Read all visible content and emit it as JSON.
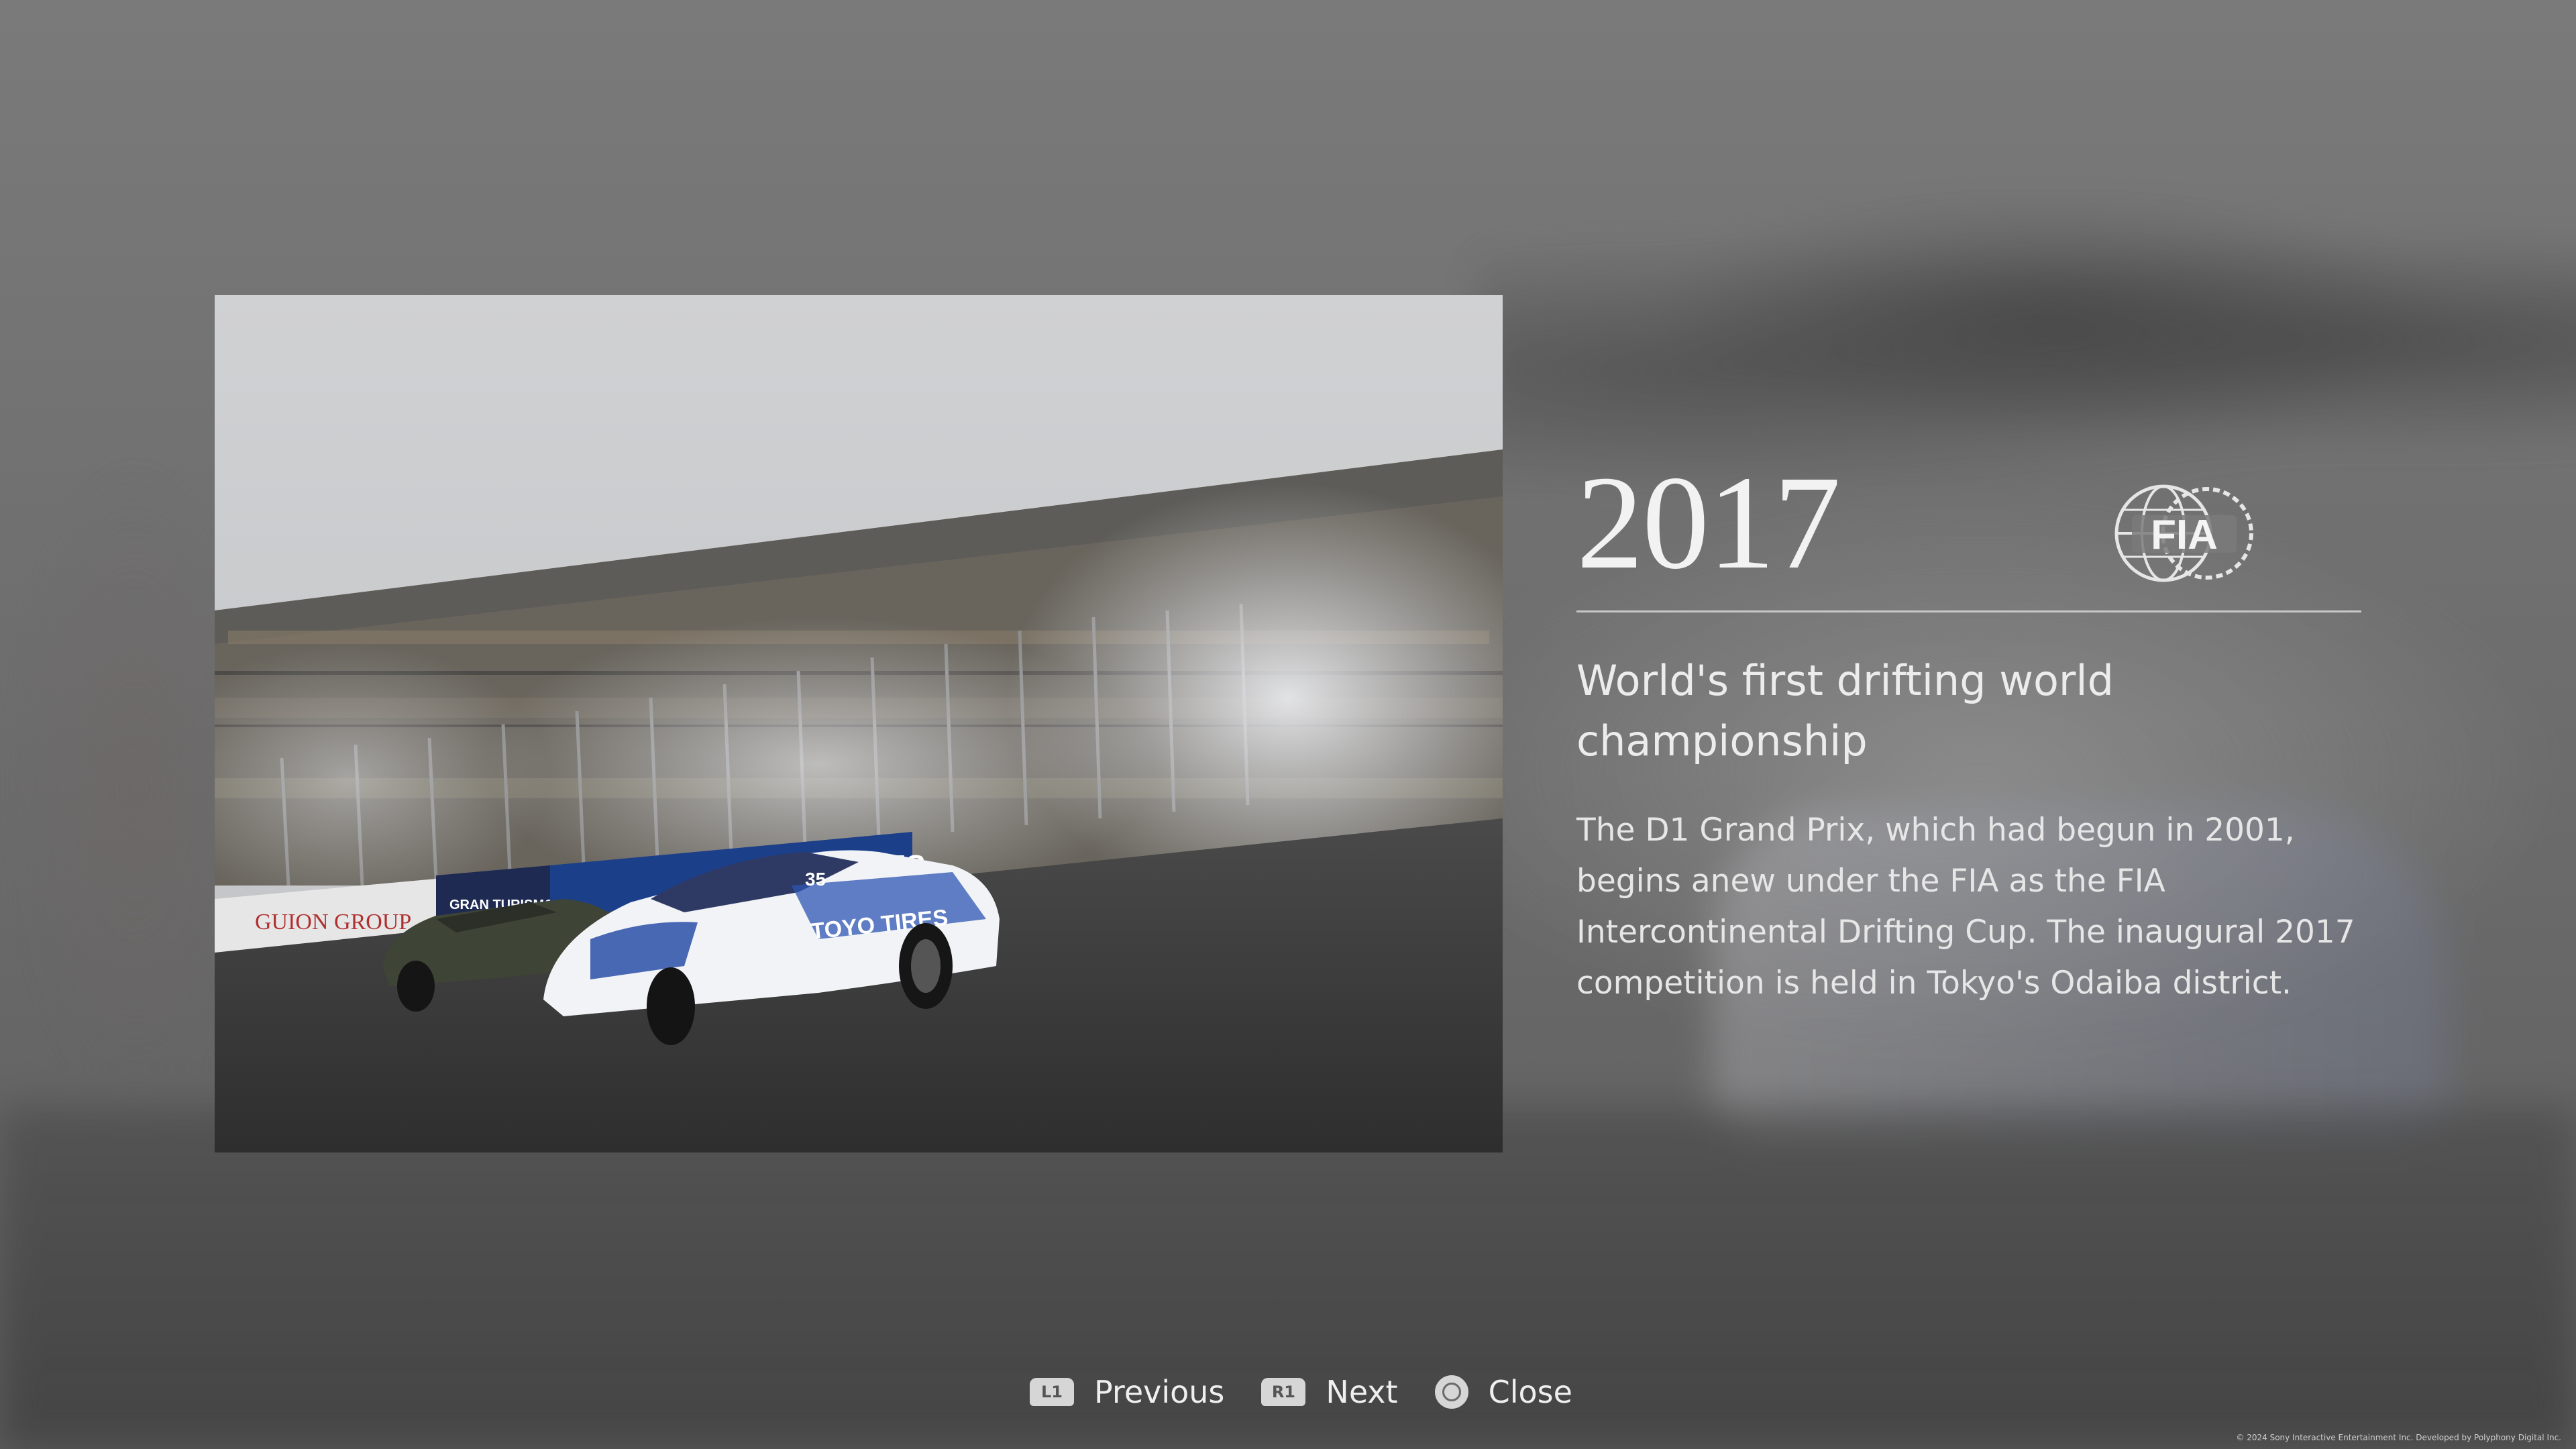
{
  "article": {
    "year": "2017",
    "headline": "World's first drifting world championship",
    "body": "The D1 Grand Prix, which had begun in 2001, begins anew under the FIA as the FIA Intercontinental Drifting Cup. The inaugural 2017 competition is held in Tokyo's Odaiba district.",
    "logo": "FIA",
    "photo": {
      "banner_left": "GUION GROUP",
      "banner_mid": "GRAN TURISMO",
      "banner_tires": "TIRES",
      "car_number": "35",
      "car_sponsor": "TOYO TIRES"
    }
  },
  "controls": {
    "previous": {
      "badge": "L1",
      "label": "Previous"
    },
    "next": {
      "badge": "R1",
      "label": "Next"
    },
    "close": {
      "label": "Close"
    }
  },
  "footer": {
    "copyright": "© 2024 Sony Interactive Entertainment Inc. Developed by Polyphony Digital Inc."
  }
}
